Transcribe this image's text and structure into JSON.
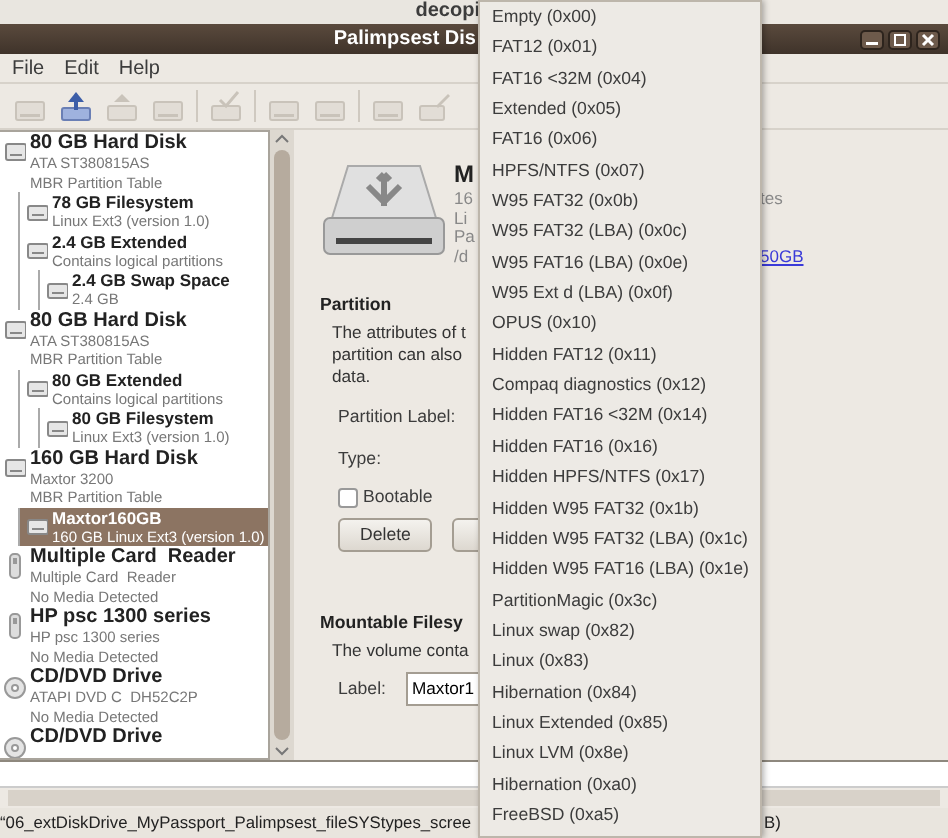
{
  "back_window": {
    "title": "decopi"
  },
  "window": {
    "title": "Palimpsest Dis"
  },
  "menubar": [
    "File",
    "Edit",
    "Help"
  ],
  "toolbar": [
    {
      "kind": "drive",
      "disabled": true
    },
    {
      "kind": "connect",
      "disabled": false
    },
    {
      "kind": "eject",
      "disabled": true
    },
    {
      "kind": "detach",
      "disabled": true
    },
    {
      "kind": "separator"
    },
    {
      "kind": "check",
      "disabled": true
    },
    {
      "kind": "separator"
    },
    {
      "kind": "mount",
      "disabled": true
    },
    {
      "kind": "unmount",
      "disabled": true
    },
    {
      "kind": "separator"
    },
    {
      "kind": "format",
      "disabled": true
    },
    {
      "kind": "edit",
      "disabled": true
    }
  ],
  "devices": [
    {
      "kind": "disk",
      "title": "80 GB Hard Disk",
      "lines": [
        "ATA ST380815AS",
        "MBR Partition Table"
      ],
      "selected": false,
      "children": [
        {
          "title": "78 GB Filesystem",
          "lines": [
            "Linux Ext3 (version 1.0)"
          ],
          "selected": false
        },
        {
          "title": "2.4 GB Extended",
          "lines": [
            "Contains logical partitions"
          ],
          "selected": false,
          "children": [
            {
              "title": "2.4 GB Swap Space",
              "lines": [
                "2.4 GB"
              ],
              "selected": false
            }
          ]
        }
      ]
    },
    {
      "kind": "disk",
      "title": "80 GB Hard Disk",
      "lines": [
        "ATA ST380815AS",
        "MBR Partition Table"
      ],
      "selected": false,
      "children": [
        {
          "title": "80 GB Extended",
          "lines": [
            "Contains logical partitions"
          ],
          "selected": false,
          "children": [
            {
              "title": "80 GB Filesystem",
              "lines": [
                "Linux Ext3 (version 1.0)"
              ],
              "selected": false
            }
          ]
        }
      ]
    },
    {
      "kind": "disk",
      "title": "160 GB Hard Disk",
      "lines": [
        "Maxtor 3200",
        "MBR Partition Table"
      ],
      "selected": false,
      "children": [
        {
          "title": "Maxtor160GB",
          "lines": [
            "160 GB Linux Ext3 (version 1.0)"
          ],
          "selected": true
        }
      ]
    },
    {
      "kind": "card",
      "title": "Multiple Card  Reader",
      "lines": [
        "Multiple Card  Reader",
        "No Media Detected"
      ],
      "selected": false
    },
    {
      "kind": "card",
      "title": "HP psc 1300 series",
      "lines": [
        "HP psc 1300 series",
        "No Media Detected"
      ],
      "selected": false
    },
    {
      "kind": "optical",
      "title": "CD/DVD Drive",
      "lines": [
        "ATAPI DVD C  DH52C2P",
        "No Media Detected"
      ],
      "selected": false
    },
    {
      "kind": "optical",
      "title": "CD/DVD Drive",
      "selected": false
    }
  ],
  "details": {
    "heading": "M",
    "rows": [
      {
        "text": "16",
        "right": "tes"
      },
      {
        "text": "Li"
      },
      {
        "text": "Pa"
      },
      {
        "text": "/d",
        "link": "50GB"
      }
    ]
  },
  "partition": {
    "heading": "Partition",
    "description": [
      "The attributes of t",
      "partition can also",
      "data."
    ],
    "label_field": "Partition Label:",
    "type_field": "Type:",
    "bootable": {
      "label": "Bootable",
      "checked": false
    },
    "buttons": [
      "Delete"
    ]
  },
  "filesystem": {
    "heading": "Mountable Filesy",
    "description": "The volume conta",
    "label": "Label:",
    "value": "Maxtor1"
  },
  "type_menu": [
    "Empty (0x00)",
    "FAT12 (0x01)",
    "FAT16 <32M (0x04)",
    "Extended (0x05)",
    "FAT16 (0x06)",
    "HPFS/NTFS (0x07)",
    "W95 FAT32 (0x0b)",
    "W95 FAT32 (LBA) (0x0c)",
    "W95 FAT16 (LBA) (0x0e)",
    "W95 Ext d (LBA) (0x0f)",
    "OPUS (0x10)",
    "Hidden FAT12 (0x11)",
    "Compaq diagnostics (0x12)",
    "Hidden FAT16 <32M (0x14)",
    "Hidden FAT16 (0x16)",
    "Hidden HPFS/NTFS (0x17)",
    "Hidden W95 FAT32 (0x1b)",
    "Hidden W95 FAT32 (LBA) (0x1c)",
    "Hidden W95 FAT16 (LBA) (0x1e)",
    "PartitionMagic (0x3c)",
    "Linux swap (0x82)",
    "Linux (0x83)",
    "Hibernation (0x84)",
    "Linux Extended (0x85)",
    "Linux LVM (0x8e)",
    "Hibernation (0xa0)",
    "FreeBSD (0xa5)"
  ],
  "status": {
    "filename": "“06_extDiskDrive_MyPassport_Palimpsest_fileSYStypes_scree",
    "right": "B)"
  }
}
